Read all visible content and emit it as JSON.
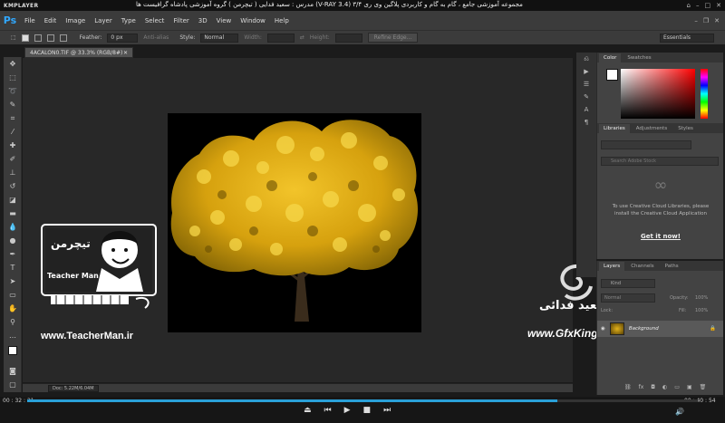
{
  "player": {
    "logo": "KMPLAYER",
    "title": "مجموعه آموزشی جامع ، گام به گام و کاربردی پلاگین وی ری ۳/۴ (V-RAY 3.4) مدرس : سعید فدایی ( تیچرمن ) گروه آموزشی پادشاه گرافیست ها",
    "time_elapsed": "00 : 32 : 21",
    "time_total": "00 : 40 : 54",
    "progress": 0.79
  },
  "ps": {
    "logo": "Ps",
    "menu": [
      "File",
      "Edit",
      "Image",
      "Layer",
      "Type",
      "Select",
      "Filter",
      "3D",
      "View",
      "Window",
      "Help"
    ],
    "options": {
      "feather_label": "Feather:",
      "feather_value": "0 px",
      "antialias": "Anti-alias",
      "style_label": "Style:",
      "style_value": "Normal",
      "width_label": "Width:",
      "height_label": "Height:",
      "refine": "Refine Edge...",
      "workspace": "Essentials"
    },
    "doc_tab": "4ACALON0.TIF @ 33.3% (RGB/8#)",
    "status_doc": "Doc: 5.22M/6.04M",
    "panels": {
      "color_tabs": [
        "Color",
        "Swatches"
      ],
      "lib_tabs": [
        "Libraries",
        "Adjustments",
        "Styles"
      ],
      "lib_search": "Search Adobe Stock",
      "cc_message": "To use Creative Cloud Libraries, please install the Creative Cloud Application",
      "cc_link": "Get it now!",
      "layer_tabs": [
        "Layers",
        "Channels",
        "Paths"
      ],
      "kind": "Kind",
      "blend": "Normal",
      "opacity_label": "Opacity:",
      "opacity": "100%",
      "lock_label": "Lock:",
      "fill_label": "Fill:",
      "fill": "100%",
      "layer_name": "Background"
    }
  },
  "watermarks": {
    "teacher_title": "تیچرمن",
    "teacher_sub": "Teacher Man",
    "teacher_url": "www.TeacherMan.ir",
    "gfx_name": "سعید فدائی",
    "gfx_url": "www.GfxKing.ir"
  }
}
